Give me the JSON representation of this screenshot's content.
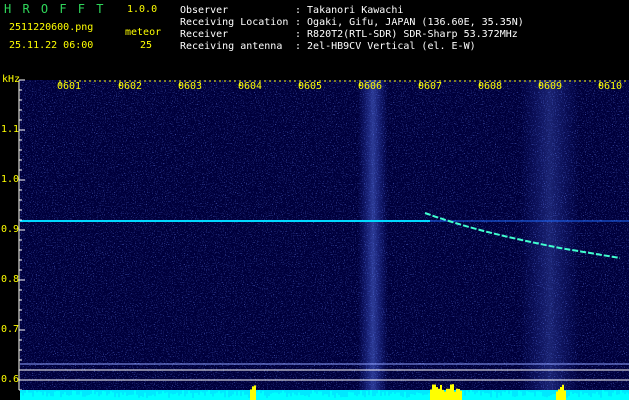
{
  "header": {
    "app_name": "H R O F F T",
    "version": "1.0.0",
    "filename": "2511220600.png",
    "timestamp": "25.11.22 06:00",
    "meteor_label": "meteor",
    "meteor_count": "25",
    "info": [
      {
        "key": "Observer",
        "value": ": Takanori Kawachi"
      },
      {
        "key": "Receiving Location",
        "value": ": Ogaki, Gifu, JAPAN (136.60E, 35.35N)"
      },
      {
        "key": "Receiver",
        "value": ": R820T2(RTL-SDR) SDR-Sharp 53.372MHz"
      },
      {
        "key": "Receiving antenna",
        "value": ": 2el-HB9CV Vertical (el. E-W)"
      }
    ]
  },
  "spectrogram": {
    "y_unit": "kHz",
    "y_ticks": [
      "1.1",
      "1.0",
      "0.9",
      "0.8",
      "0.7",
      "0.6"
    ],
    "x_ticks": [
      "0601",
      "0602",
      "0603",
      "0604",
      "0605",
      "0606",
      "0607",
      "0608",
      "0609",
      "0610"
    ],
    "colors": {
      "background": "#000040",
      "signal": "#00ffff",
      "strong": "#ffff00",
      "noise": "#3040ff"
    }
  }
}
